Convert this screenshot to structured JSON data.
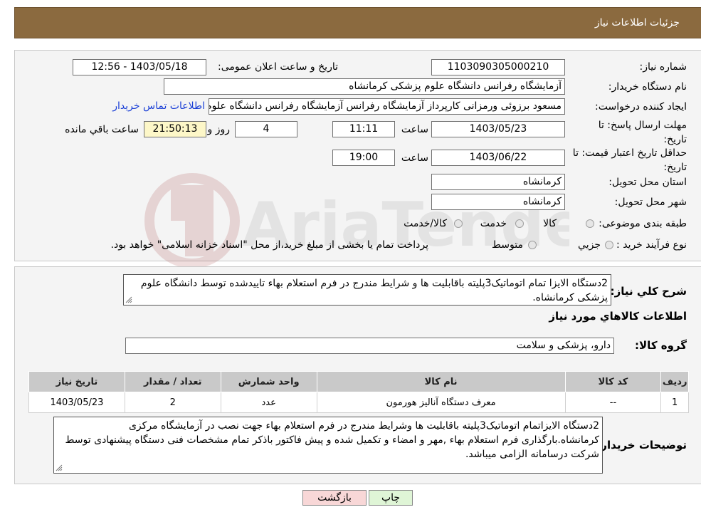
{
  "header": {
    "title": "جزئیات اطلاعات نیاز"
  },
  "fields": {
    "need_number": {
      "label": "شماره نیاز:",
      "value": "1103090305000210"
    },
    "announce": {
      "label": "تاریخ و ساعت اعلان عمومی:",
      "value": "1403/05/18 - 12:56"
    },
    "buyer": {
      "label": "نام دستگاه خریدار:",
      "value": "آزمایشگاه رفرانس دانشگاه علوم پزشکی کرمانشاه"
    },
    "creator": {
      "label": "ایجاد کننده درخواست:",
      "value": "مسعود برزوئی ورمزانی کارپرداز آزمایشگاه رفرانس آزمایشگاه رفرانس دانشگاه علوم",
      "contact_link": "اطلاعات تماس خریدار"
    },
    "reply_deadline": {
      "label": "مهلت ارسال پاسخ: تا تاریخ:",
      "date": "1403/05/23",
      "time_label": "ساعت",
      "time": "11:11",
      "days": "4",
      "days_label": "روز و",
      "remaining": "21:50:13",
      "remaining_label": "ساعت باقي مانده"
    },
    "price_validity": {
      "label": "حداقل تاریخ اعتبار قیمت: تا تاریخ:",
      "date": "1403/06/22",
      "time_label": "ساعت",
      "time": "19:00"
    },
    "province": {
      "label": "استان محل تحویل:",
      "value": "کرمانشاه"
    },
    "city": {
      "label": "شهر محل تحویل:",
      "value": "کرمانشاه"
    },
    "category": {
      "label": "طبقه بندی موضوعی:",
      "options": [
        "کالا",
        "خدمت",
        "کالا/خدمت"
      ]
    },
    "process": {
      "label": "نوع فرآیند خرید :",
      "options": [
        "جزیي",
        "متوسط"
      ],
      "note": "پرداخت تمام یا بخشی از مبلغ خرید،از محل \"اسناد خزانه اسلامی\" خواهد بود."
    }
  },
  "description": {
    "label": "شرح کلي نياز:",
    "text": "2دستگاه الایزا تمام اتوماتیک3پلیته باقابلیت ها و شرایط مندرج در فرم استعلام بهاء تاییدشده توسط دانشگاه علوم پزشکی کرمانشاه."
  },
  "goods_info": {
    "title": "اطلاعات کالاهاي مورد نياز",
    "group_label": "گروه کالا:",
    "group_value": "دارو، پزشکی و سلامت"
  },
  "table": {
    "headers": [
      "رديف",
      "کد کالا",
      "نام کالا",
      "واحد شمارش",
      "تعداد / مقدار",
      "تاریخ نیاز"
    ],
    "rows": [
      [
        "1",
        "--",
        "معرف دستگاه آنالیز هورمون",
        "عدد",
        "2",
        "1403/05/23"
      ]
    ]
  },
  "buyer_notes": {
    "label": "توضیحات خریدار:",
    "text": "2دستگاه الایزاتمام اتوماتیک3پلیته باقابلیت ها وشرایط مندرج در فرم استعلام بهاء جهت نصب در آزمایشگاه مرکزی کرمانشاه.بارگذاری فرم استعلام بهاء ,مهر و امضاء و تکمیل شده و پیش فاکتور باذکر تمام مشخصات فنی دستگاه پیشنهادی توسط شرکت درسامانه الزامی میباشد."
  },
  "buttons": {
    "print": "چاپ",
    "back": "بازگشت"
  },
  "watermark": "AriaTender.neT",
  "colors": {
    "header_bg": "#8b6a3f",
    "link": "#1a3fd6",
    "back_button": "#f8d7d7",
    "print_button": "#dff5d6",
    "remaining_bg": "#fdf7c8"
  }
}
